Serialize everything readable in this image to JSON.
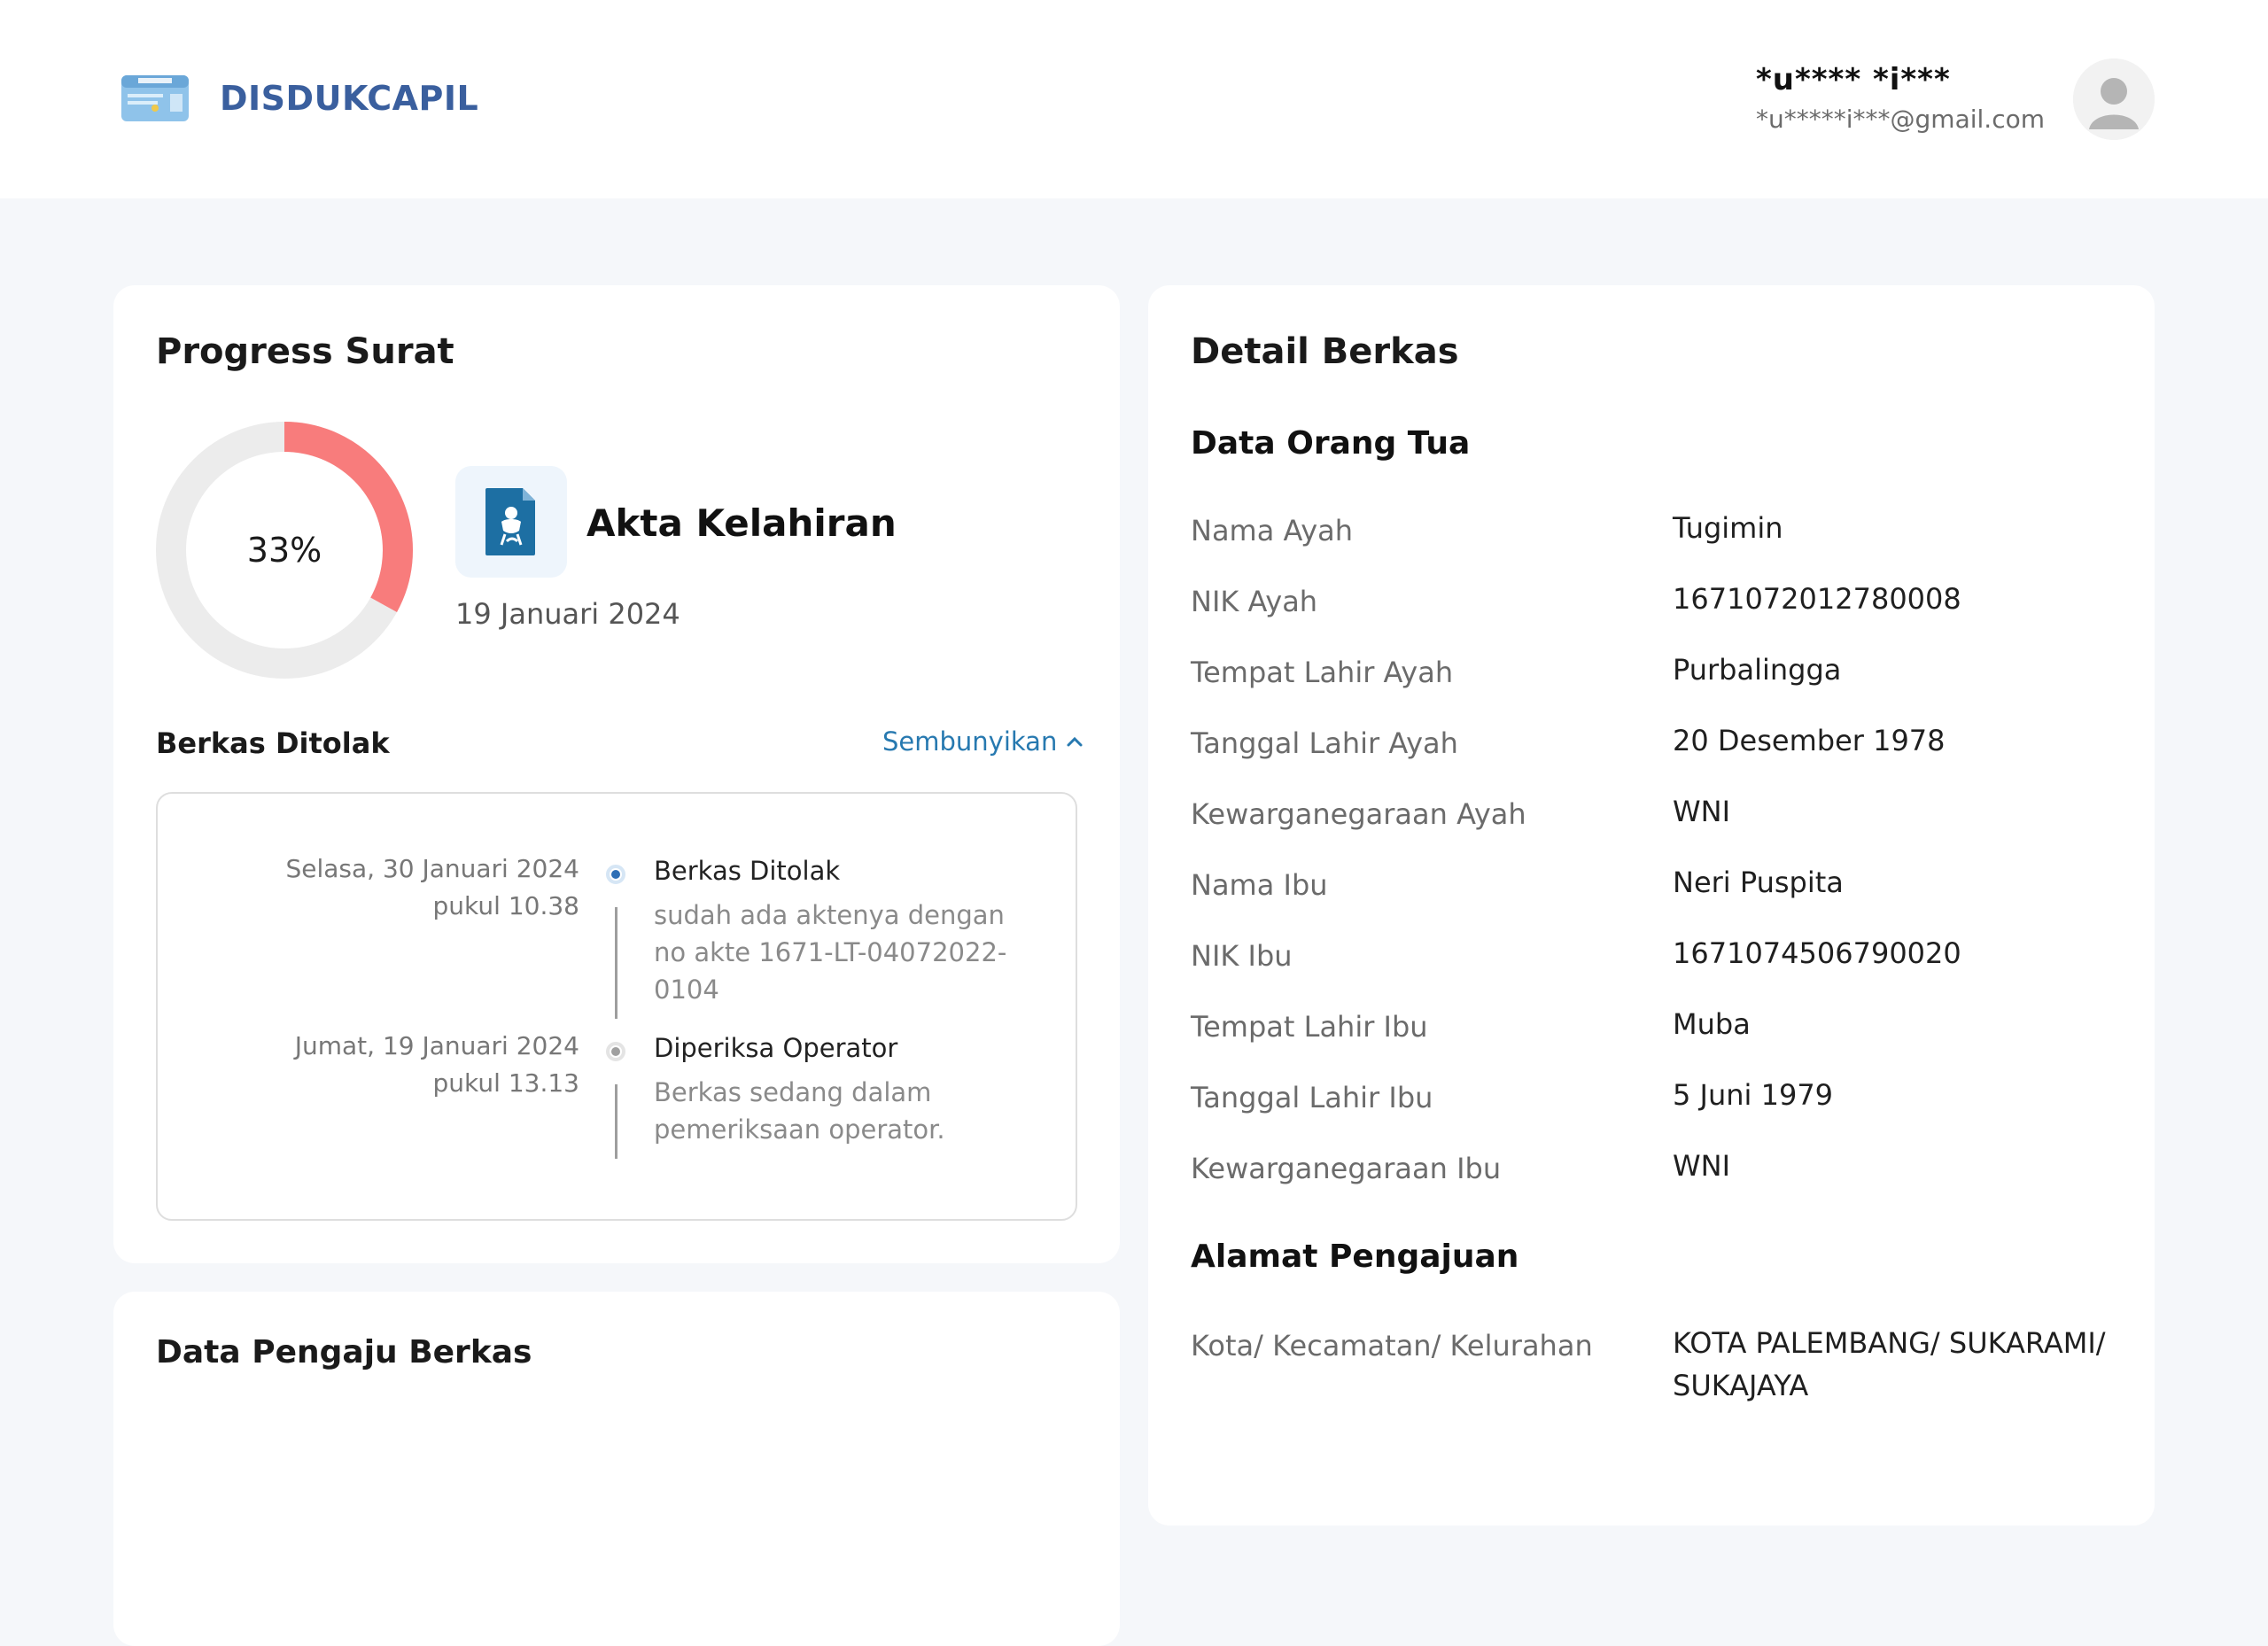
{
  "header": {
    "logo_icon": "ktp-card-icon",
    "brand": "DISDUKCAPIL",
    "user_name": "*u**** *i***",
    "user_email": "*u*****i***@gmail.com",
    "avatar_icon": "user-avatar-icon"
  },
  "progress": {
    "title": "Progress Surat",
    "percent_label": "33%",
    "percent_value": 0.33,
    "document_icon": "birth-certificate-icon",
    "document_title": "Akta Kelahiran",
    "document_date": "19 Januari 2024",
    "status_heading": "Berkas Ditolak",
    "toggle_label": "Sembunyikan",
    "toggle_icon": "chevron-up-icon",
    "colors": {
      "progress": "#f87c7c",
      "track": "#ececec",
      "active_dot": "#2f6fb5",
      "inactive_dot": "#a0a0a0"
    },
    "timeline": [
      {
        "date": "Selasa, 30 Januari 2024",
        "time": "pukul 10.38",
        "title": "Berkas Ditolak",
        "desc": "sudah ada aktenya dengan no akte 1671-LT-04072022-0104",
        "active": true
      },
      {
        "date": "Jumat, 19 Januari 2024",
        "time": "pukul 13.13",
        "title": "Diperiksa Operator",
        "desc": "Berkas sedang dalam pemeriksaan operator.",
        "active": false
      }
    ]
  },
  "pengaju": {
    "title": "Data Pengaju Berkas"
  },
  "detail": {
    "title": "Detail Berkas",
    "section_parents": "Data Orang Tua",
    "rows": [
      {
        "label": "Nama Ayah",
        "value": "Tugimin"
      },
      {
        "label": "NIK Ayah",
        "value": "1671072012780008"
      },
      {
        "label": "Tempat Lahir Ayah",
        "value": "Purbalingga"
      },
      {
        "label": "Tanggal Lahir Ayah",
        "value": "20 Desember 1978"
      },
      {
        "label": "Kewarganegaraan Ayah",
        "value": "WNI"
      },
      {
        "label": "Nama Ibu",
        "value": "Neri Puspita"
      },
      {
        "label": "NIK Ibu",
        "value": "1671074506790020"
      },
      {
        "label": "Tempat Lahir Ibu",
        "value": "Muba"
      },
      {
        "label": "Tanggal Lahir Ibu",
        "value": "5 Juni 1979"
      },
      {
        "label": "Kewarganegaraan Ibu",
        "value": "WNI"
      }
    ],
    "section_address": "Alamat Pengajuan",
    "address_rows": [
      {
        "label": "Kota/ Kecamatan/ Kelurahan",
        "value": "KOTA PALEMBANG/ SUKARAMI/ SUKAJAYA"
      }
    ]
  }
}
